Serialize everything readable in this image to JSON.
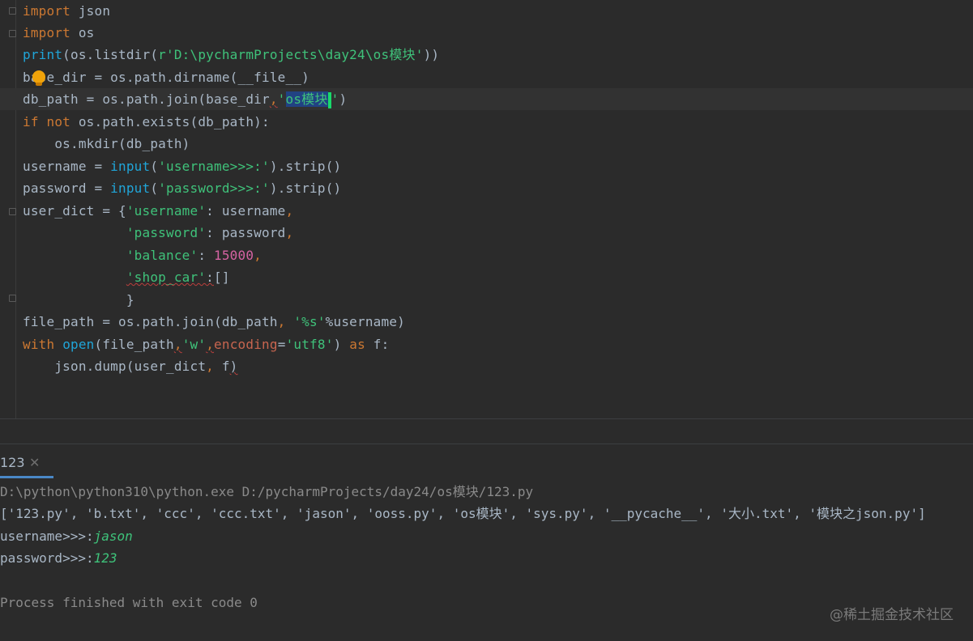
{
  "editor": {
    "lines": [
      {
        "segments": [
          {
            "t": "import",
            "c": "kw"
          },
          {
            "t": " json",
            "c": "dn"
          }
        ]
      },
      {
        "segments": [
          {
            "t": "import",
            "c": "kw"
          },
          {
            "t": " os",
            "c": "dn"
          }
        ]
      },
      {
        "segments": [
          {
            "t": "print",
            "c": "bi"
          },
          {
            "t": "(os.listdir(",
            "c": "dn"
          },
          {
            "t": "r'D:\\pycharmProjects\\day24\\os模块'",
            "c": "st"
          },
          {
            "t": "))",
            "c": "dn"
          }
        ]
      },
      {
        "segments": [
          {
            "t": "base_dir = os.path.dirname(__file__)",
            "c": "dn"
          }
        ]
      },
      {
        "segments": [
          {
            "t": "db_path = os.path.join(base_dir",
            "c": "dn"
          },
          {
            "t": ",",
            "c": "cm squig"
          },
          {
            "t": "'",
            "c": "st"
          },
          {
            "t": "os模块",
            "c": "sel"
          },
          {
            "t": "'",
            "c": "st cursor-after"
          },
          {
            "t": ")",
            "c": "dn"
          }
        ]
      },
      {
        "segments": [
          {
            "t": "if not",
            "c": "kw"
          },
          {
            "t": " os.path.exists(db_path):",
            "c": "dn"
          }
        ]
      },
      {
        "segments": [
          {
            "t": "    os.mkdir(db_path)",
            "c": "dn"
          }
        ]
      },
      {
        "segments": [
          {
            "t": "username = ",
            "c": "dn"
          },
          {
            "t": "input",
            "c": "bi"
          },
          {
            "t": "(",
            "c": "dn"
          },
          {
            "t": "'username>>>:'",
            "c": "st"
          },
          {
            "t": ").strip()",
            "c": "dn"
          }
        ]
      },
      {
        "segments": [
          {
            "t": "password = ",
            "c": "dn"
          },
          {
            "t": "input",
            "c": "bi"
          },
          {
            "t": "(",
            "c": "dn"
          },
          {
            "t": "'password>>>:'",
            "c": "st"
          },
          {
            "t": ").strip()",
            "c": "dn"
          }
        ]
      },
      {
        "segments": [
          {
            "t": "user_dict = {",
            "c": "dn"
          },
          {
            "t": "'username'",
            "c": "st"
          },
          {
            "t": ": username",
            "c": "dn"
          },
          {
            "t": ",",
            "c": "cm"
          }
        ]
      },
      {
        "segments": [
          {
            "t": "             ",
            "c": "dn"
          },
          {
            "t": "'password'",
            "c": "st"
          },
          {
            "t": ": password",
            "c": "dn"
          },
          {
            "t": ",",
            "c": "cm"
          }
        ]
      },
      {
        "segments": [
          {
            "t": "             ",
            "c": "dn"
          },
          {
            "t": "'balance'",
            "c": "st"
          },
          {
            "t": ": ",
            "c": "dn"
          },
          {
            "t": "15000",
            "c": "nm"
          },
          {
            "t": ",",
            "c": "cm"
          }
        ]
      },
      {
        "segments": [
          {
            "t": "             ",
            "c": "dn"
          },
          {
            "t": "'shop_car'",
            "c": "st squig"
          },
          {
            "t": ":",
            "c": "dn squig"
          },
          {
            "t": "[]",
            "c": "dn"
          }
        ]
      },
      {
        "segments": [
          {
            "t": "             }",
            "c": "dn"
          }
        ]
      },
      {
        "segments": [
          {
            "t": "file_path = os.path.join(db_path",
            "c": "dn"
          },
          {
            "t": ", ",
            "c": "cm"
          },
          {
            "t": "'%s'",
            "c": "st"
          },
          {
            "t": "%username)",
            "c": "dn"
          }
        ]
      },
      {
        "segments": [
          {
            "t": "with",
            "c": "kw"
          },
          {
            "t": " ",
            "c": "dn"
          },
          {
            "t": "open",
            "c": "bi"
          },
          {
            "t": "(file_path",
            "c": "dn"
          },
          {
            "t": ",",
            "c": "cm squig"
          },
          {
            "t": "'w'",
            "c": "st"
          },
          {
            "t": ",",
            "c": "cm squig"
          },
          {
            "t": "encoding",
            "c": "pm"
          },
          {
            "t": "=",
            "c": "dn"
          },
          {
            "t": "'utf8'",
            "c": "st"
          },
          {
            "t": ") ",
            "c": "dn"
          },
          {
            "t": "as",
            "c": "kw"
          },
          {
            "t": " f:",
            "c": "dn"
          }
        ]
      },
      {
        "segments": [
          {
            "t": "    json.dump(user_dict",
            "c": "dn"
          },
          {
            "t": ", ",
            "c": "cm"
          },
          {
            "t": "f",
            "c": "dn"
          },
          {
            "t": ")",
            "c": "dn squig"
          }
        ]
      }
    ],
    "lightbulb_icon": "intention-bulb-icon"
  },
  "run": {
    "tab_label": "123",
    "close_glyph": "✕"
  },
  "console": {
    "command": "D:\\python\\python310\\python.exe D:/pycharmProjects/day24/os模块/123.py",
    "listing": "['123.py', 'b.txt', 'ccc', 'ccc.txt', 'jason', 'ooss.py', 'os模块', 'sys.py', '__pycache__', '大小.txt', '模块之json.py']",
    "prompt_username": "username>>>:",
    "input_username": "jason",
    "prompt_password": "password>>>:",
    "input_password": "123",
    "finish": "Process finished with exit code 0"
  },
  "watermark": "@稀土掘金技术社区",
  "colors": {
    "background": "#2b2b2b",
    "keyword": "#cc7832",
    "builtin": "#20a5d8",
    "string": "#3fc27a",
    "number": "#d663a3",
    "text": "#a9b7c6"
  }
}
